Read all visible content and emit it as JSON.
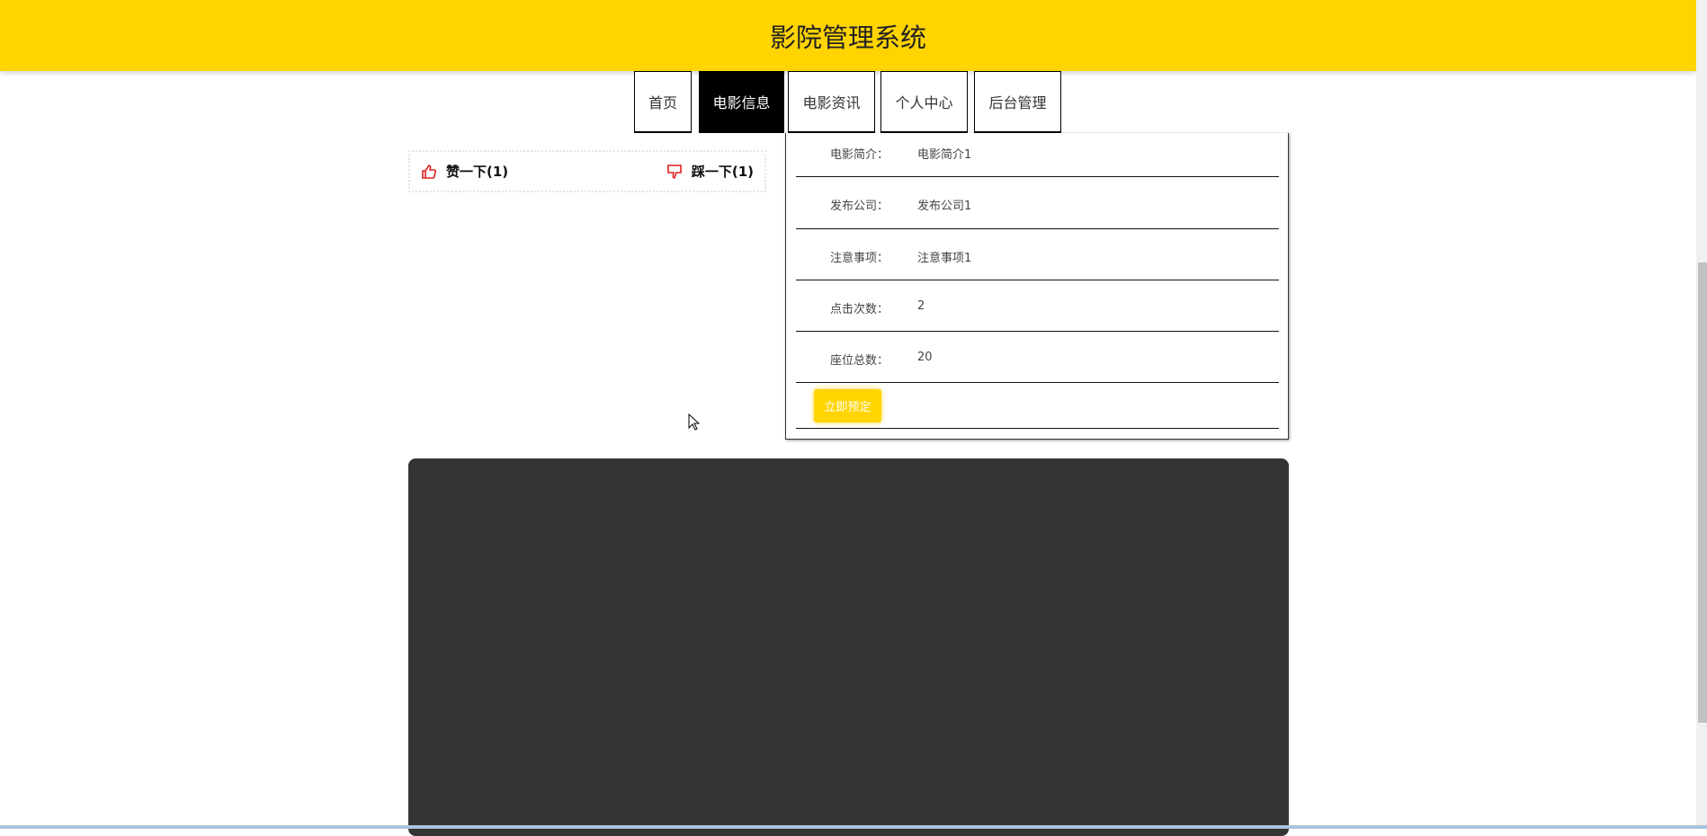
{
  "header": {
    "title": "影院管理系统"
  },
  "nav": [
    {
      "label": "首页"
    },
    {
      "label": "电影信息",
      "active": true
    },
    {
      "label": "电影资讯"
    },
    {
      "label": "个人中心"
    },
    {
      "label": "后台管理"
    }
  ],
  "vote": {
    "like": "赞一下(1)",
    "dislike": "踩一下(1)"
  },
  "details": [
    {
      "label": "电影简介：",
      "value": "电影简介1"
    },
    {
      "label": "发布公司：",
      "value": "发布公司1"
    },
    {
      "label": "注意事项：",
      "value": "注意事项1"
    },
    {
      "label": "点击次数：",
      "value": "2"
    },
    {
      "label": "座位总数：",
      "value": "20"
    }
  ],
  "book_button": "立即预定",
  "colors": {
    "accent": "#FFD400",
    "icon_red": "#e02020",
    "dark_panel": "#343434"
  }
}
